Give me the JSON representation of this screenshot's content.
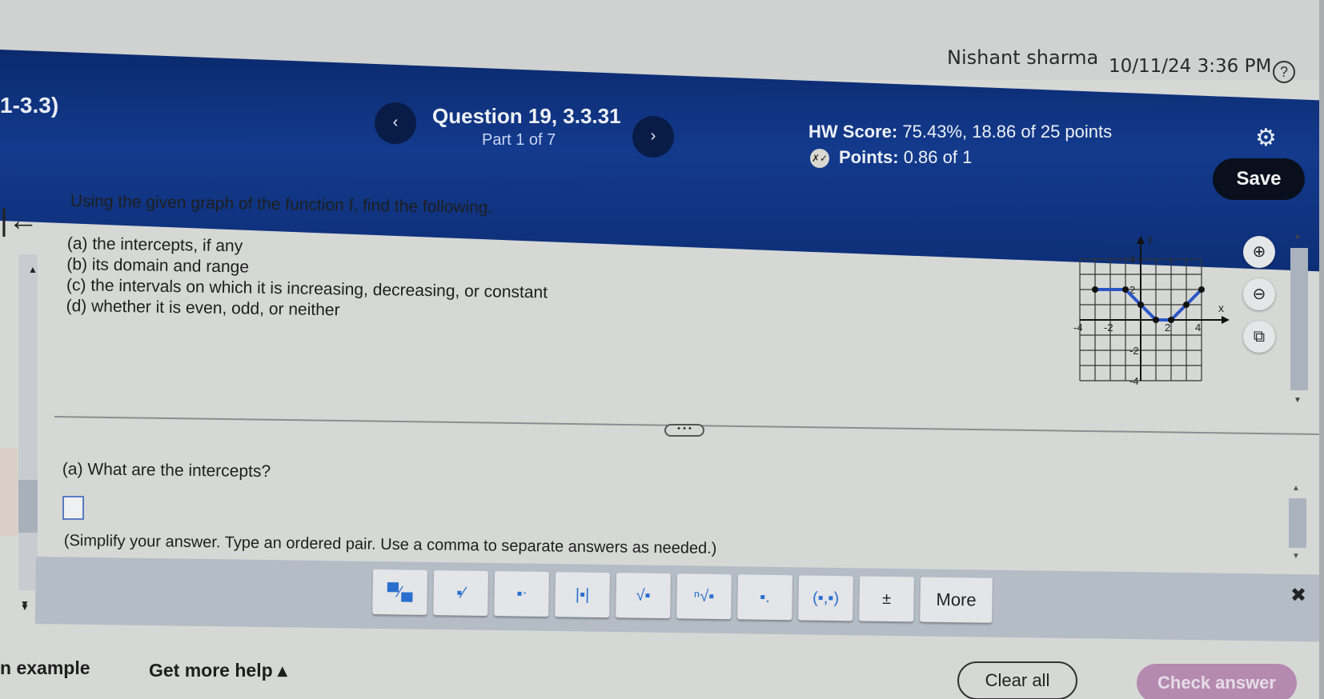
{
  "header": {
    "user_name": "Nishant sharma",
    "datetime": "10/11/24 3:36 PM",
    "help_icon": "?"
  },
  "banner": {
    "section_code": "1-3.3)",
    "question_title": "Question 19, 3.3.31",
    "part_label": "Part 1 of 7",
    "prev_icon": "‹",
    "next_icon": "›",
    "hw_score_label": "HW Score:",
    "hw_score_value": "75.43%, 18.86 of 25 points",
    "points_label": "Points:",
    "points_value": "0.86 of 1",
    "points_icon": "✗✓",
    "settings_icon": "⚙",
    "save_label": "Save"
  },
  "sidebar": {
    "back_icon": "|←",
    "scroll_up": "▲",
    "scroll_down": "▼"
  },
  "question": {
    "prompt": "Using the given graph of the function f, find the following.",
    "parts": [
      "(a)  the intercepts, if any",
      "(b)  its domain and range",
      "(c)  the intervals on which it is increasing, decreasing, or constant",
      "(d)  whether it is even, odd, or neither"
    ]
  },
  "graph": {
    "x_label": "x",
    "y_label": "y",
    "x_ticks": [
      "-4",
      "-2",
      "2",
      "4"
    ],
    "y_ticks": [
      "4",
      "2",
      "-2",
      "-4"
    ],
    "range": {
      "xmin": -5,
      "xmax": 5,
      "ymin": -5,
      "ymax": 5
    },
    "line_color": "#2a56c4",
    "points": [
      [
        -3,
        2
      ],
      [
        -1,
        2
      ],
      [
        0,
        1
      ],
      [
        1,
        0
      ],
      [
        2,
        0
      ],
      [
        3,
        1
      ],
      [
        4,
        2
      ]
    ],
    "tools": {
      "zoom_in": "⊕",
      "zoom_out": "⊖",
      "popout": "⧉"
    }
  },
  "expand_label": "• • •",
  "answer": {
    "question": "(a)  What are the intercepts?",
    "value": "",
    "instructions": "(Simplify your answer. Type an ordered pair. Use a comma to separate answers as needed.)"
  },
  "keypad": {
    "buttons": [
      {
        "name": "fraction",
        "label": "▀⁄▄"
      },
      {
        "name": "mixed-number",
        "label": "▪⁄"
      },
      {
        "name": "exponent",
        "label": "▪ᐧ"
      },
      {
        "name": "absolute-value",
        "label": "|▪|"
      },
      {
        "name": "square-root",
        "label": "√▪"
      },
      {
        "name": "nth-root",
        "label": "ⁿ√▪"
      },
      {
        "name": "subscript",
        "label": "▪.",
        "sub": true
      },
      {
        "name": "ordered-pair",
        "label": "(▪,▪)"
      },
      {
        "name": "plus-minus",
        "label": "±"
      }
    ],
    "more_label": "More",
    "close_icon": "✖",
    "collapse_icon": "▼"
  },
  "footer": {
    "view_example": "n example",
    "more_help": "Get more help ▴",
    "clear_all": "Clear all",
    "check_answer": "Check answer"
  }
}
